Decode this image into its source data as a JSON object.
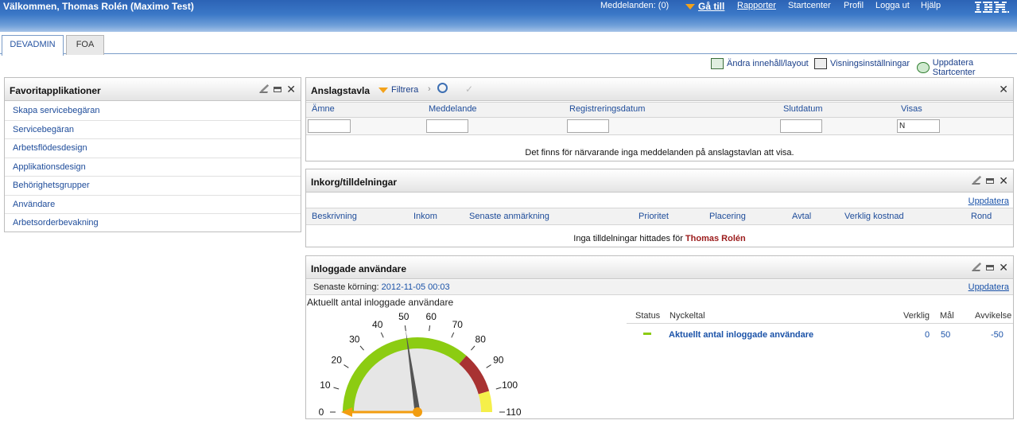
{
  "header": {
    "welcome": "Välkommen, Thomas Rolén (Maximo Test)",
    "messages": "Meddelanden: (0)",
    "goto": "Gå till",
    "reports": "Rapporter",
    "startcenter": "Startcenter",
    "profile": "Profil",
    "logout": "Logga ut",
    "help": "Hjälp",
    "logo": "IBM."
  },
  "tabs": [
    {
      "label": "DEVADMIN",
      "active": true
    },
    {
      "label": "FOA",
      "active": false
    }
  ],
  "toolbar": {
    "change_layout": "Ändra innehåll/layout",
    "display_settings": "Visningsinställningar",
    "refresh_startcenter": "Uppdatera Startcenter"
  },
  "favorites": {
    "title": "Favoritapplikationer",
    "items": [
      "Skapa servicebegäran",
      "Servicebegäran",
      "Arbetsflödesdesign",
      "Applikationsdesign",
      "Behörighetsgrupper",
      "Användare",
      "Arbetsorderbevakning"
    ]
  },
  "bulletin": {
    "title": "Anslagstavla",
    "filter_label": "Filtrera",
    "columns": [
      "Ämne",
      "Meddelande",
      "Registreringsdatum",
      "Slutdatum",
      "Visas"
    ],
    "visas_filter_value": "N",
    "empty_message": "Det finns för närvarande inga meddelanden på anslagstavlan att visa."
  },
  "inbox": {
    "title": "Inkorg/tilldelningar",
    "refresh": "Uppdatera",
    "columns": [
      "Beskrivning",
      "Inkom",
      "Senaste anmärkning",
      "Prioritet",
      "Placering",
      "Avtal",
      "Verklig kostnad",
      "Rond"
    ],
    "empty_prefix": "Inga tilldelningar hittades för",
    "empty_user": "Thomas Rolén"
  },
  "logged_in": {
    "title": "Inloggade användare",
    "last_run_label": "Senaste körning:",
    "last_run_value": "2012-11-05 00:03",
    "refresh": "Uppdatera",
    "gauge_title": "Aktuellt antal inloggade användare",
    "gauge": {
      "min": 0,
      "max": 110,
      "step": 10,
      "value": 0,
      "target": 50,
      "ticks": [
        "0",
        "10",
        "20",
        "30",
        "40",
        "50",
        "60",
        "70",
        "80",
        "90",
        "100",
        "110"
      ],
      "bands": [
        {
          "from": 0,
          "to": 80,
          "color": "#8ccc12"
        },
        {
          "from": 80,
          "to": 100,
          "color": "#a83232"
        },
        {
          "from": 100,
          "to": 110,
          "color": "#f5ef4a"
        }
      ]
    },
    "kpi_columns": [
      "Status",
      "Nyckeltal",
      "Verklig",
      "Mål",
      "Avvikelse"
    ],
    "kpi_row": {
      "name": "Aktuellt antal inloggade användare",
      "actual": "0",
      "target": "50",
      "variance": "-50",
      "status_color": "#8ccc12"
    }
  }
}
